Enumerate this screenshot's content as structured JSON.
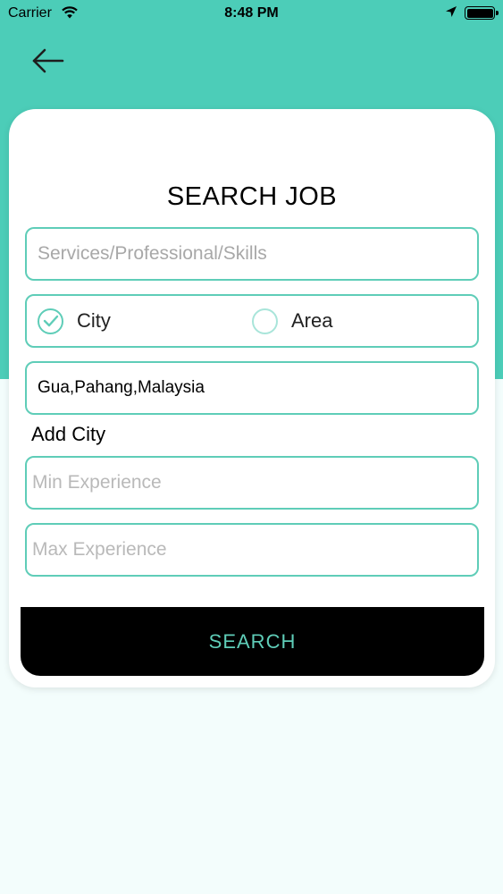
{
  "status_bar": {
    "carrier": "Carrier",
    "time": "8:48 PM"
  },
  "header": {
    "back_icon": "arrow-left-icon"
  },
  "form": {
    "title": "SEARCH JOB",
    "skills_placeholder": "Services/Professional/Skills",
    "skills_value": "",
    "location_type": {
      "options": [
        "City",
        "Area"
      ],
      "selected": "City"
    },
    "location_value": "Gua,Pahang,Malaysia",
    "add_city_label": "Add City",
    "min_experience_placeholder": "Min Experience",
    "max_experience_placeholder": "Max Experience",
    "search_label": "SEARCH"
  },
  "colors": {
    "accent": "#4ccdb8",
    "field_border": "#5fcdb8",
    "button_bg": "#000000",
    "page_bg": "#f3fdfc"
  }
}
